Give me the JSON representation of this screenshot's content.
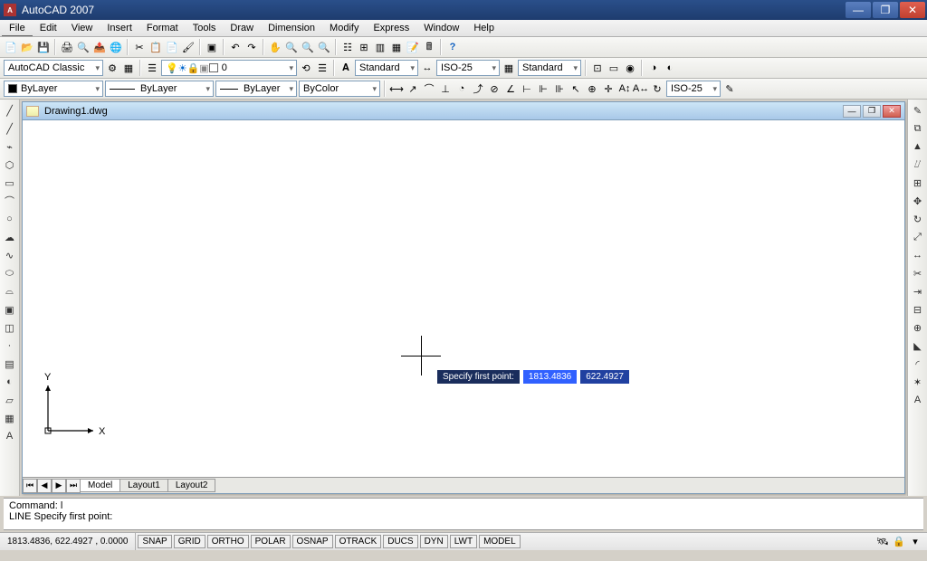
{
  "window": {
    "title": "AutoCAD 2007"
  },
  "menu": [
    "File",
    "Edit",
    "View",
    "Insert",
    "Format",
    "Tools",
    "Draw",
    "Dimension",
    "Modify",
    "Express",
    "Window",
    "Help"
  ],
  "row2": {
    "workspace": "AutoCAD Classic",
    "layer": "0",
    "textstyle": "Standard",
    "dimstyle": "ISO-25",
    "tablestyle": "Standard"
  },
  "row3": {
    "propcolor": "ByLayer",
    "propline": "ByLayer",
    "proplw": "ByLayer",
    "plotstyle": "ByColor",
    "dimstyle2": "ISO-25"
  },
  "doc": {
    "title": "Drawing1.dwg"
  },
  "dynprompt": {
    "label": "Specify first point:",
    "x": "1813.4836",
    "y": "622.4927"
  },
  "ucs": {
    "xlabel": "X",
    "ylabel": "Y"
  },
  "tabs": {
    "model": "Model",
    "l1": "Layout1",
    "l2": "Layout2"
  },
  "cmd": {
    "line1": "Command: l",
    "line2": "LINE Specify first point:"
  },
  "status": {
    "coords": "1813.4836, 622.4927 , 0.0000",
    "toggles": [
      "SNAP",
      "GRID",
      "ORTHO",
      "POLAR",
      "OSNAP",
      "OTRACK",
      "DUCS",
      "DYN",
      "LWT",
      "MODEL"
    ]
  }
}
